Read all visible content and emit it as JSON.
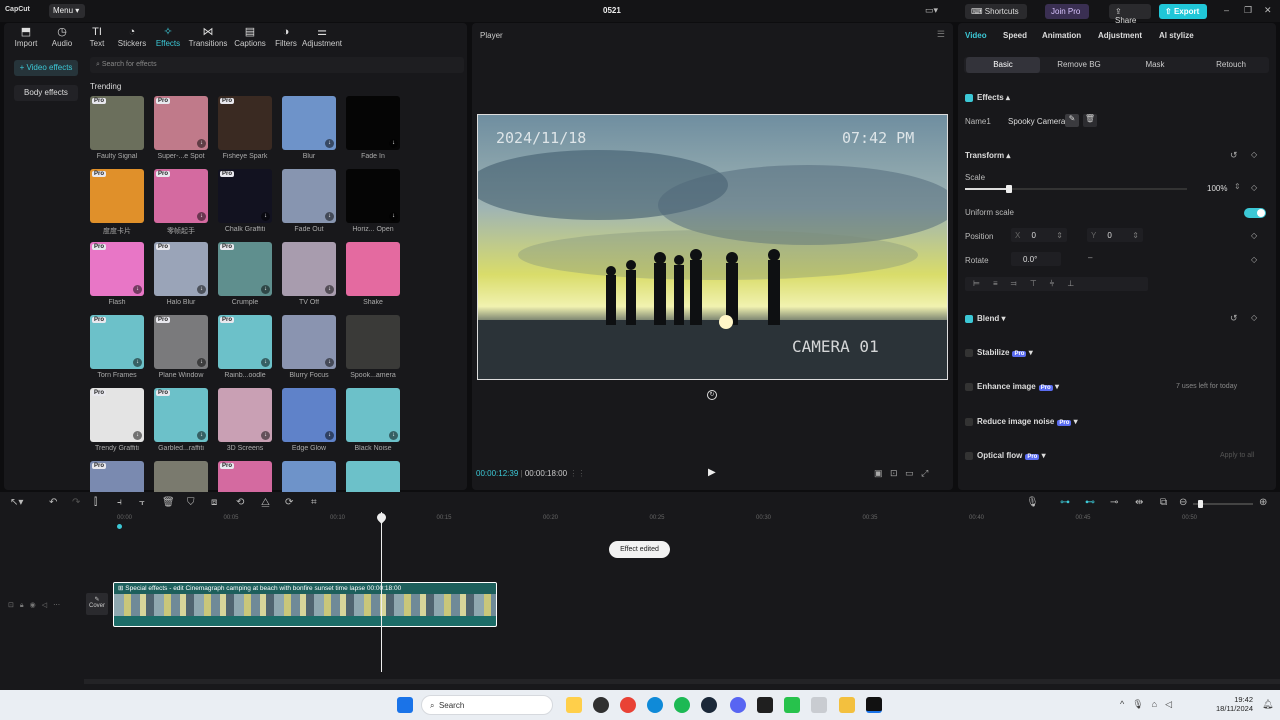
{
  "titlebar": {
    "app": "CapCut",
    "menu": "Menu",
    "project": "0521",
    "shortcuts": "Shortcuts",
    "join_pro": "Join Pro",
    "share": "Share",
    "export": "Export"
  },
  "toolbar": [
    {
      "label": "Import",
      "icon": "import-icon",
      "glyph": "⬒"
    },
    {
      "label": "Audio",
      "icon": "audio-icon",
      "glyph": "◷"
    },
    {
      "label": "Text",
      "icon": "text-icon",
      "glyph": "TI"
    },
    {
      "label": "Stickers",
      "icon": "stickers-icon",
      "glyph": "◔"
    },
    {
      "label": "Effects",
      "icon": "effects-icon",
      "glyph": "✧"
    },
    {
      "label": "Transitions",
      "icon": "transitions-icon",
      "glyph": "⋈"
    },
    {
      "label": "Captions",
      "icon": "captions-icon",
      "glyph": "▤"
    },
    {
      "label": "Filters",
      "icon": "filters-icon",
      "glyph": "◑"
    },
    {
      "label": "Adjustment",
      "icon": "adjustment-icon",
      "glyph": "⚌"
    }
  ],
  "sidebar": {
    "video_effects": "+ Video effects",
    "body_effects": "Body effects"
  },
  "search": {
    "placeholder": "Search for effects"
  },
  "section": "Trending",
  "effects": [
    {
      "label": "Faulty Signal",
      "pro": true,
      "dl": false,
      "bg": "#6b6f5c"
    },
    {
      "label": "Super-...e Spot",
      "pro": true,
      "dl": true,
      "bg": "#c07a8a"
    },
    {
      "label": "Fisheye Spark",
      "pro": true,
      "dl": false,
      "bg": "#3a2a22"
    },
    {
      "label": "Blur",
      "pro": false,
      "dl": true,
      "bg": "#6e93c9"
    },
    {
      "label": "Fade In",
      "pro": false,
      "dl": true,
      "bg": "#050505"
    },
    {
      "label": "度度卡片",
      "pro": true,
      "dl": false,
      "bg": "#e0902a"
    },
    {
      "label": "零帧起手",
      "pro": true,
      "dl": true,
      "bg": "#d46aa0"
    },
    {
      "label": "Chalk Graffiti",
      "pro": true,
      "dl": true,
      "bg": "#121220"
    },
    {
      "label": "Fade Out",
      "pro": false,
      "dl": true,
      "bg": "#8795b0"
    },
    {
      "label": "Horiz... Open",
      "pro": false,
      "dl": true,
      "bg": "#050505"
    },
    {
      "label": "Flash",
      "pro": true,
      "dl": true,
      "bg": "#e876c6"
    },
    {
      "label": "Halo Blur",
      "pro": true,
      "dl": true,
      "bg": "#9aa4b8"
    },
    {
      "label": "Crumple",
      "pro": true,
      "dl": true,
      "bg": "#5f8f8e"
    },
    {
      "label": "TV Off",
      "pro": false,
      "dl": true,
      "bg": "#a89cae"
    },
    {
      "label": "Shake",
      "pro": false,
      "dl": false,
      "bg": "#e46aa0"
    },
    {
      "label": "Torn Frames",
      "pro": true,
      "dl": true,
      "bg": "#6cc1c9"
    },
    {
      "label": "Plane Window",
      "pro": true,
      "dl": true,
      "bg": "#7a7a7c"
    },
    {
      "label": "Rainb...oodle",
      "pro": true,
      "dl": true,
      "bg": "#6cc1c9"
    },
    {
      "label": "Blurry Focus",
      "pro": false,
      "dl": true,
      "bg": "#8a94b0"
    },
    {
      "label": "Spook...amera",
      "pro": false,
      "dl": false,
      "bg": "#3a3a38"
    },
    {
      "label": "Trendy Graffiti",
      "pro": true,
      "dl": true,
      "bg": "#e4e4e4"
    },
    {
      "label": "Garbled...raffiti",
      "pro": true,
      "dl": true,
      "bg": "#6cc1c9"
    },
    {
      "label": "3D Screens",
      "pro": false,
      "dl": true,
      "bg": "#c9a0b4"
    },
    {
      "label": "Edge Glow",
      "pro": false,
      "dl": true,
      "bg": "#5f82c9"
    },
    {
      "label": "Black Noise",
      "pro": false,
      "dl": true,
      "bg": "#6cc1c9"
    },
    {
      "label": "",
      "pro": true,
      "dl": false,
      "bg": "#7a8ab0"
    },
    {
      "label": "",
      "pro": false,
      "dl": false,
      "bg": "#7a7a6e"
    },
    {
      "label": "",
      "pro": true,
      "dl": false,
      "bg": "#d46aa0"
    },
    {
      "label": "",
      "pro": false,
      "dl": false,
      "bg": "#6e93c9"
    },
    {
      "label": "",
      "pro": false,
      "dl": false,
      "bg": "#6cc1c9"
    }
  ],
  "player": {
    "title": "Player",
    "date_stamp": "2024/11/18",
    "time_stamp": "07:42 PM",
    "camera_label": "CAMERA 01",
    "current_time": "00:00:12:39",
    "total_time": "00:00:18:00"
  },
  "right": {
    "tabs": [
      "Video",
      "Speed",
      "Animation",
      "Adjustment",
      "AI stylize"
    ],
    "subtabs": [
      "Basic",
      "Remove BG",
      "Mask",
      "Retouch"
    ],
    "effects_title": "Effects",
    "name_label": "Name1",
    "name_value": "Spooky Camera",
    "transform_title": "Transform",
    "scale_label": "Scale",
    "scale_value": "100%",
    "scale_level": 0.2,
    "uniform_label": "Uniform scale",
    "position_label": "Position",
    "x_label": "X",
    "x_value": "0",
    "y_label": "Y",
    "y_value": "0",
    "rotate_label": "Rotate",
    "rotate_value": "0.0°",
    "blend_title": "Blend",
    "stabilize": "Stabilize",
    "enhance": "Enhance image",
    "enhance_note": "7 uses left for today",
    "noise": "Reduce image noise",
    "optical": "Optical flow",
    "apply_all": "Apply to all",
    "pro_badge": "Pro"
  },
  "timeline": {
    "ticks": [
      "00:00",
      "00:05",
      "00:10",
      "00:15",
      "00:20",
      "00:25",
      "00:30",
      "00:35",
      "00:40",
      "00:45",
      "00:50"
    ],
    "toast": "Effect edited",
    "clip_label": "Special effects - edit  Cinemagraph camping at beach with bonfire sunset time lapse  00:00:18:00",
    "cover": "Cover"
  },
  "taskbar": {
    "search": "Search",
    "time": "19:42",
    "date": "18/11/2024"
  },
  "colors": {
    "accent": "#3cc8d6",
    "join_pro": "#c9a6ff",
    "export": "#20c7d8"
  }
}
